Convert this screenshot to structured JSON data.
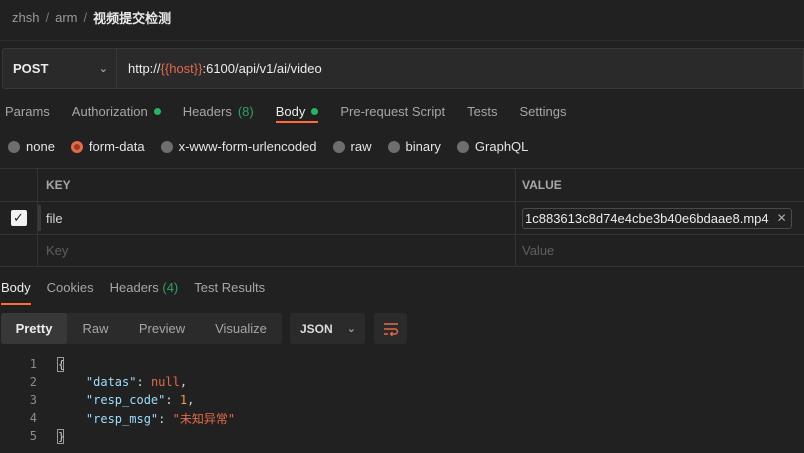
{
  "breadcrumb": {
    "workspace": "zhsh",
    "collection": "arm",
    "request": "视频提交检测"
  },
  "request": {
    "method": "POST",
    "url_prefix": "http://",
    "url_var": "{{host}}",
    "url_suffix": ":6100/api/v1/ai/video"
  },
  "req_tabs": {
    "params": "Params",
    "authorization": "Authorization",
    "headers": "Headers",
    "headers_count": "(8)",
    "body": "Body",
    "prerequest": "Pre-request Script",
    "tests": "Tests",
    "settings": "Settings"
  },
  "body_types": {
    "none": "none",
    "form_data": "form-data",
    "urlencoded": "x-www-form-urlencoded",
    "raw": "raw",
    "binary": "binary",
    "graphql": "GraphQL",
    "selected": "form-data"
  },
  "kv_table": {
    "key_header": "KEY",
    "value_header": "VALUE",
    "row_key": "file",
    "row_value": "1c883613c8d74e4cbe3b40e6bdaae8.mp4",
    "key_placeholder": "Key",
    "value_placeholder": "Value"
  },
  "resp_tabs": {
    "body": "Body",
    "cookies": "Cookies",
    "headers": "Headers",
    "headers_count": "(4)",
    "test_results": "Test Results"
  },
  "view_modes": {
    "pretty": "Pretty",
    "raw": "Raw",
    "preview": "Preview",
    "visualize": "Visualize",
    "format": "JSON"
  },
  "response_code": {
    "line_numbers": [
      "1",
      "2",
      "3",
      "4",
      "5"
    ],
    "key_datas": "\"datas\"",
    "val_datas": "null",
    "key_code": "\"resp_code\"",
    "val_code": "1",
    "key_msg": "\"resp_msg\"",
    "val_msg": "\"未知异常\"",
    "open_brace": "{",
    "close_brace": "}"
  },
  "colors": {
    "accent": "#ff6c37",
    "variable": "#e36a4b",
    "status_green": "#28b463",
    "background": "#212121"
  }
}
